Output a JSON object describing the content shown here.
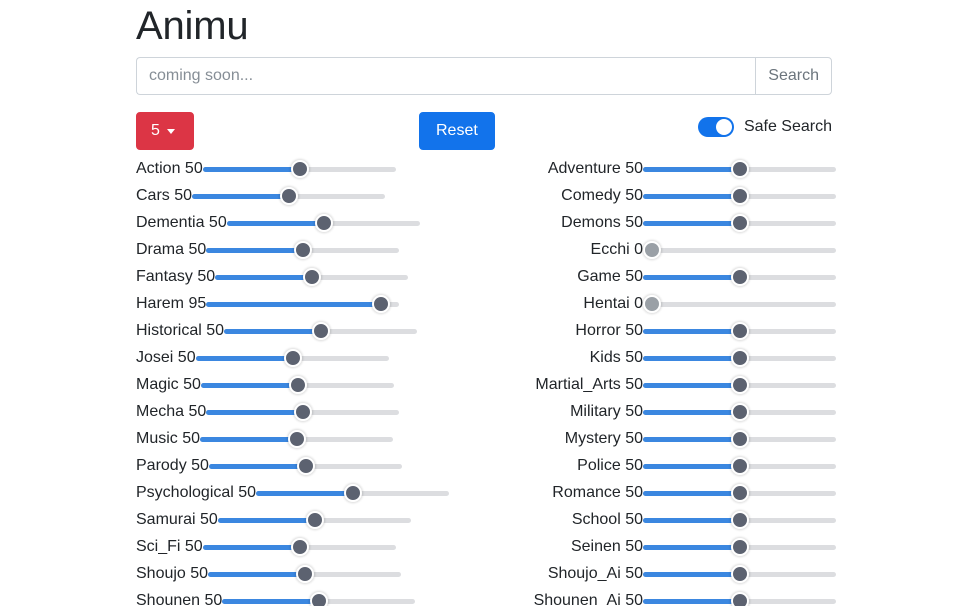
{
  "header": {
    "title": "Animu"
  },
  "search": {
    "placeholder": "coming soon...",
    "value": "",
    "button_label": "Search"
  },
  "controls": {
    "page_size_label": "5",
    "page_size_icon": "caret-down-icon",
    "reset_label": "Reset",
    "safe_search_label": "Safe Search",
    "safe_search_on": true
  },
  "colors": {
    "accent_blue": "#1273eb",
    "slider_blue": "#3b87e0",
    "danger_red": "#dc3545",
    "thumb_gray": "#5c6270",
    "thumb_zero_gray": "#9aa0a6",
    "track_gray": "#dcdde0"
  },
  "slider_min": 0,
  "slider_max": 100,
  "columns": {
    "left": [
      {
        "name": "Action",
        "value": 50,
        "text": "Action 50"
      },
      {
        "name": "Cars",
        "value": 50,
        "text": "Cars 50"
      },
      {
        "name": "Dementia",
        "value": 50,
        "text": "Dementia 50"
      },
      {
        "name": "Drama",
        "value": 50,
        "text": "Drama 50"
      },
      {
        "name": "Fantasy",
        "value": 50,
        "text": "Fantasy 50"
      },
      {
        "name": "Harem",
        "value": 95,
        "text": "Harem 95"
      },
      {
        "name": "Historical",
        "value": 50,
        "text": "Historical 50"
      },
      {
        "name": "Josei",
        "value": 50,
        "text": "Josei 50"
      },
      {
        "name": "Magic",
        "value": 50,
        "text": "Magic 50"
      },
      {
        "name": "Mecha",
        "value": 50,
        "text": "Mecha 50"
      },
      {
        "name": "Music",
        "value": 50,
        "text": "Music 50"
      },
      {
        "name": "Parody",
        "value": 50,
        "text": "Parody 50"
      },
      {
        "name": "Psychological",
        "value": 50,
        "text": "Psychological 50"
      },
      {
        "name": "Samurai",
        "value": 50,
        "text": "Samurai 50"
      },
      {
        "name": "Sci_Fi",
        "value": 50,
        "text": "Sci_Fi 50"
      },
      {
        "name": "Shoujo",
        "value": 50,
        "text": "Shoujo 50"
      },
      {
        "name": "Shounen",
        "value": 50,
        "text": "Shounen 50"
      }
    ],
    "right": [
      {
        "name": "Adventure",
        "value": 50,
        "text": "Adventure 50"
      },
      {
        "name": "Comedy",
        "value": 50,
        "text": "Comedy 50"
      },
      {
        "name": "Demons",
        "value": 50,
        "text": "Demons 50"
      },
      {
        "name": "Ecchi",
        "value": 0,
        "text": "Ecchi 0"
      },
      {
        "name": "Game",
        "value": 50,
        "text": "Game 50"
      },
      {
        "name": "Hentai",
        "value": 0,
        "text": "Hentai 0"
      },
      {
        "name": "Horror",
        "value": 50,
        "text": "Horror 50"
      },
      {
        "name": "Kids",
        "value": 50,
        "text": "Kids 50"
      },
      {
        "name": "Martial_Arts",
        "value": 50,
        "text": "Martial_Arts 50"
      },
      {
        "name": "Military",
        "value": 50,
        "text": "Military 50"
      },
      {
        "name": "Mystery",
        "value": 50,
        "text": "Mystery 50"
      },
      {
        "name": "Police",
        "value": 50,
        "text": "Police 50"
      },
      {
        "name": "Romance",
        "value": 50,
        "text": "Romance 50"
      },
      {
        "name": "School",
        "value": 50,
        "text": "School 50"
      },
      {
        "name": "Seinen",
        "value": 50,
        "text": "Seinen 50"
      },
      {
        "name": "Shoujo_Ai",
        "value": 50,
        "text": "Shoujo_Ai 50"
      },
      {
        "name": "Shounen_Ai",
        "value": 50,
        "text": "Shounen_Ai 50"
      }
    ]
  }
}
